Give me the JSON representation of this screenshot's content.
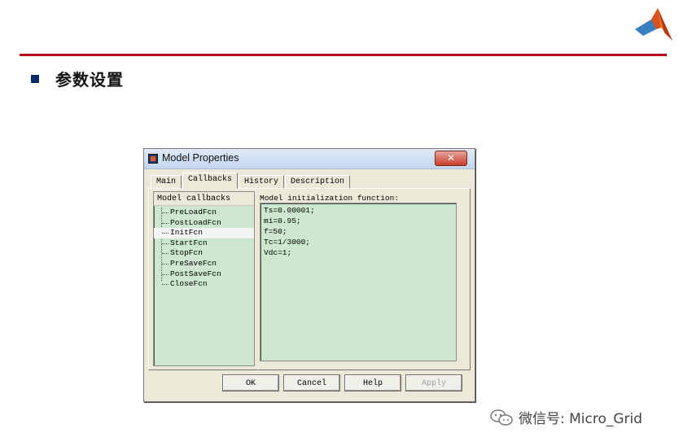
{
  "slide": {
    "heading": "参数设置",
    "watermark": "微信号: Micro_Grid",
    "colors": {
      "rule": "#b0001e",
      "bullet": "#0a2a6a"
    },
    "logo_icon": "matlab-logo-icon"
  },
  "dialog": {
    "title": "Model Properties",
    "close_glyph": "✕",
    "tabs": [
      {
        "label": "Main"
      },
      {
        "label": "Callbacks",
        "active": true
      },
      {
        "label": "History"
      },
      {
        "label": "Description"
      }
    ],
    "callbacks_header": "Model callbacks",
    "callbacks": [
      {
        "label": "PreLoadFcn"
      },
      {
        "label": "PostLoadFcn"
      },
      {
        "label": "InitFcn",
        "selected": true
      },
      {
        "label": "StartFcn"
      },
      {
        "label": "StopFcn"
      },
      {
        "label": "PreSaveFcn"
      },
      {
        "label": "PostSaveFcn"
      },
      {
        "label": "CloseFcn"
      }
    ],
    "function_label": "Model initialization function:",
    "code_lines": [
      "Ts=0.00001;",
      "mi=0.95;",
      "f=50;",
      "Tc=1/3000;",
      "Vdc=1;"
    ],
    "buttons": {
      "ok": "OK",
      "cancel": "Cancel",
      "help": "Help",
      "apply": "Apply"
    },
    "colors": {
      "editor_bg": "#cde8cf",
      "dialog_bg": "#ece9d8"
    }
  }
}
